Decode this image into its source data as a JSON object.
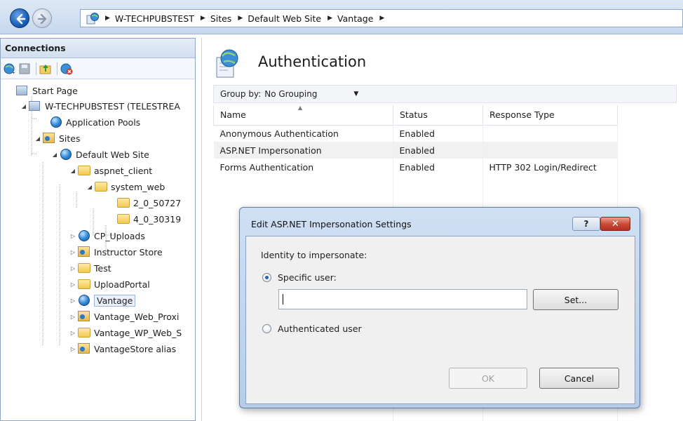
{
  "address": {
    "crumbs": [
      "W-TECHPUBSTEST",
      "Sites",
      "Default Web Site",
      "Vantage"
    ]
  },
  "connections": {
    "title": "Connections",
    "tree": [
      {
        "label": "Start Page"
      },
      {
        "label": "W-TECHPUBSTEST (TELESTREA"
      },
      {
        "label": "Application Pools"
      },
      {
        "label": "Sites"
      },
      {
        "label": "Default Web Site"
      },
      {
        "label": "aspnet_client"
      },
      {
        "label": "system_web"
      },
      {
        "label": "2_0_50727"
      },
      {
        "label": "4_0_30319"
      },
      {
        "label": "CP_Uploads"
      },
      {
        "label": "Instructor Store"
      },
      {
        "label": "Test"
      },
      {
        "label": "UploadPortal"
      },
      {
        "label": "Vantage"
      },
      {
        "label": "Vantage_Web_Proxi"
      },
      {
        "label": "Vantage_WP_Web_S"
      },
      {
        "label": "VantageStore alias"
      }
    ]
  },
  "main": {
    "title": "Authentication",
    "group_label": "Group by:",
    "group_value": "No Grouping",
    "columns": [
      "Name",
      "Status",
      "Response Type"
    ],
    "rows": [
      {
        "name": "Anonymous Authentication",
        "status": "Enabled",
        "response": ""
      },
      {
        "name": "ASP.NET Impersonation",
        "status": "Enabled",
        "response": ""
      },
      {
        "name": "Forms Authentication",
        "status": "Enabled",
        "response": "HTTP 302 Login/Redirect"
      }
    ]
  },
  "dialog": {
    "title": "Edit ASP.NET Impersonation Settings",
    "help_label": "?",
    "close_label": "✕",
    "identity_label": "Identity to impersonate:",
    "specific_user_label": "Specific user:",
    "specific_user_value": "",
    "set_label": "Set...",
    "authenticated_user_label": "Authenticated user",
    "ok_label": "OK",
    "cancel_label": "Cancel",
    "selected_option": "specific-user"
  }
}
